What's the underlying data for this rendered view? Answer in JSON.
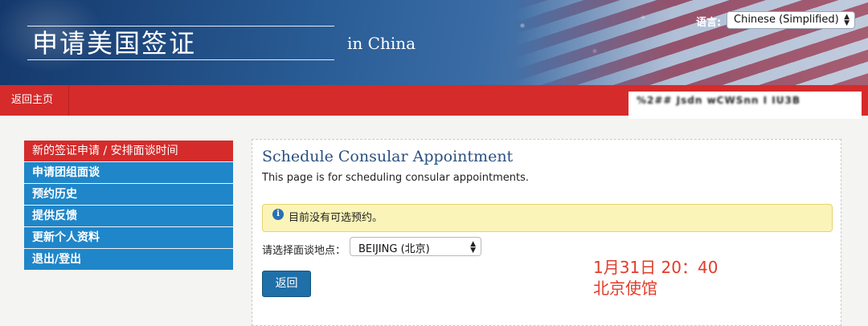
{
  "header": {
    "site_title": "申请美国签证",
    "site_subtitle": "in  China",
    "language_label": "语言:",
    "language_selected": "Chinese (Simplified)"
  },
  "nav": {
    "home_link": "返回主页",
    "user_info_redacted": "%2##  Jsdn wCWSnn  I IU3B"
  },
  "sidebar": {
    "items": [
      {
        "label": "新的签证申请 / 安排面谈时间",
        "active": true
      },
      {
        "label": "申请团组面谈",
        "active": false
      },
      {
        "label": "预约历史",
        "active": false
      },
      {
        "label": "提供反馈",
        "active": false
      },
      {
        "label": "更新个人资料",
        "active": false
      },
      {
        "label": "退出/登出",
        "active": false
      }
    ]
  },
  "main": {
    "title": "Schedule Consular Appointment",
    "description": "This page is for scheduling consular appointments.",
    "alert": {
      "icon": "info-icon",
      "message": "目前没有可选预约。"
    },
    "location_label": "请选择面谈地点：",
    "location_selected": "BEIJING (北京)",
    "back_button": "返回"
  },
  "annotation": {
    "line1": "1月31日 20：40",
    "line2": "北京使馆"
  },
  "colors": {
    "nav_red": "#d52b2b",
    "sidebar_blue": "#1f86c9",
    "button_blue": "#1f6fa8",
    "alert_yellow": "#fbf4b8",
    "title_blue": "#2a5080",
    "annotation_red": "#e23b28"
  }
}
